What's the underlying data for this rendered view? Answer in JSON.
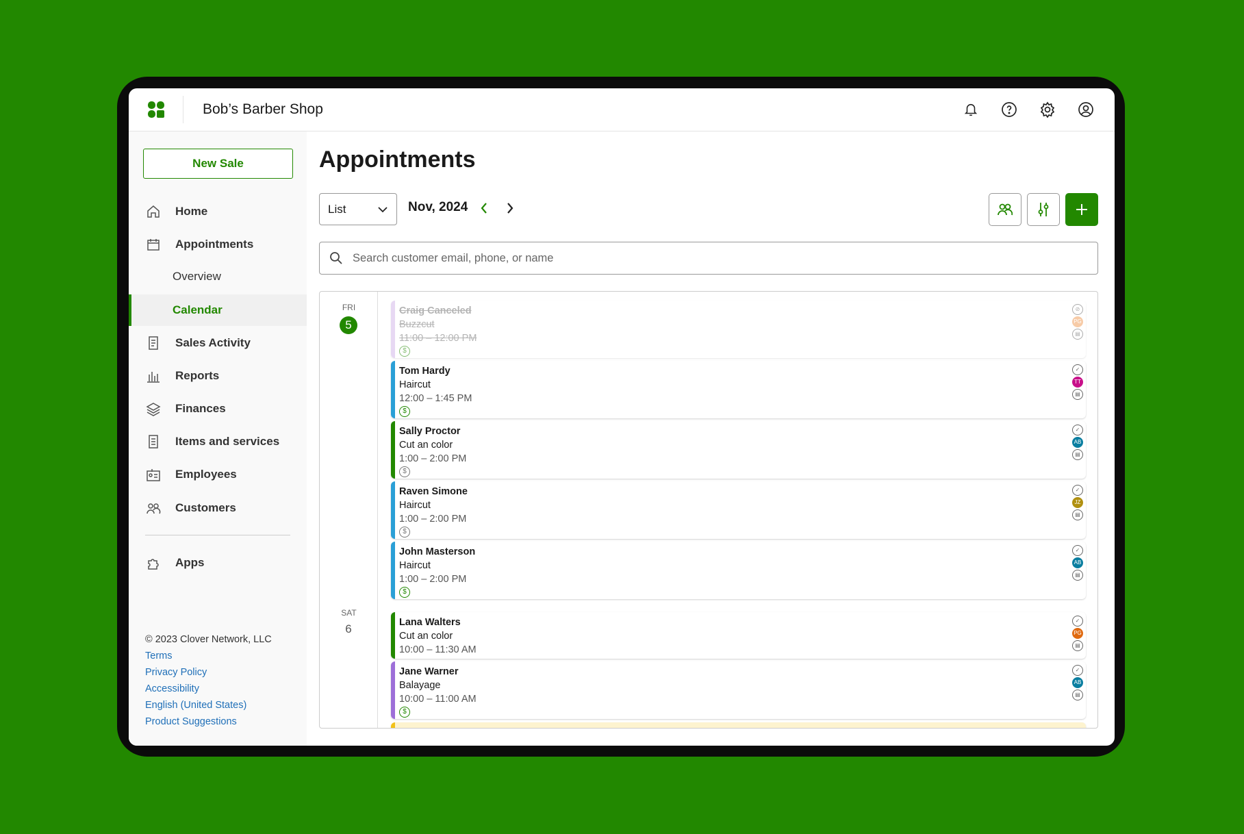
{
  "header": {
    "shop_name": "Bob’s Barber Shop"
  },
  "sidebar": {
    "new_sale": "New Sale",
    "items": [
      {
        "label": "Home",
        "icon": "home-icon"
      },
      {
        "label": "Appointments",
        "icon": "calendar-icon"
      },
      {
        "label": "Overview",
        "sub": true
      },
      {
        "label": "Calendar",
        "sub": true,
        "active": true
      },
      {
        "label": "Sales Activity",
        "icon": "receipt-icon"
      },
      {
        "label": "Reports",
        "icon": "bar-chart-icon"
      },
      {
        "label": "Finances",
        "icon": "layers-icon"
      },
      {
        "label": "Items and services",
        "icon": "list-icon"
      },
      {
        "label": "Employees",
        "icon": "id-card-icon"
      },
      {
        "label": "Customers",
        "icon": "people-icon"
      },
      {
        "label": "Apps",
        "icon": "puzzle-icon"
      }
    ],
    "footer": {
      "copyright": "© 2023 Clover Network, LLC",
      "links": [
        "Terms",
        "Privacy Policy",
        "Accessibility",
        "English (United States)",
        "Product Suggestions"
      ]
    }
  },
  "main": {
    "title": "Appointments",
    "view": "List",
    "month": "Nov, 2024",
    "search_placeholder": "Search customer email, phone, or name",
    "days": [
      {
        "dow": "FRI",
        "num": "5"
      },
      {
        "dow": "SAT",
        "num": "6"
      }
    ],
    "appointments": [
      {
        "name": "Craig Canceled",
        "service": "Buzzcut",
        "time": "11:00 – 12:00 PM",
        "color": "#d3b8ea",
        "paid": true,
        "initials": "PG",
        "avatar": "#f0a060",
        "canceled": true
      },
      {
        "name": "Tom Hardy",
        "service": "Haircut",
        "time": "12:00 – 1:45 PM",
        "color": "#2a9fd6",
        "paid": true,
        "initials": "TT",
        "avatar": "#c8108a"
      },
      {
        "name": "Sally Proctor",
        "service": "Cut an color",
        "time": "1:00 – 2:00 PM",
        "color": "#228800",
        "paid": false,
        "initials": "AB",
        "avatar": "#0a7ea0"
      },
      {
        "name": "Raven Simone",
        "service": "Haircut",
        "time": "1:00 – 2:00 PM",
        "color": "#2a9fd6",
        "paid": false,
        "initials": "JZ",
        "avatar": "#b09010"
      },
      {
        "name": "John Masterson",
        "service": "Haircut",
        "time": "1:00 – 2:00 PM",
        "color": "#2a9fd6",
        "paid": true,
        "initials": "AB",
        "avatar": "#0a7ea0"
      },
      {
        "name": "Lana Walters",
        "service": "Cut an color",
        "time": "10:00 – 11:30 AM",
        "color": "#228800",
        "initials": "PG",
        "avatar": "#e06a10"
      },
      {
        "name": "Jane Warner",
        "service": "Balayage",
        "time": "10:00 – 11:00 AM",
        "color": "#9d6fd8",
        "paid": true,
        "initials": "AB",
        "avatar": "#0a7ea0"
      }
    ]
  }
}
